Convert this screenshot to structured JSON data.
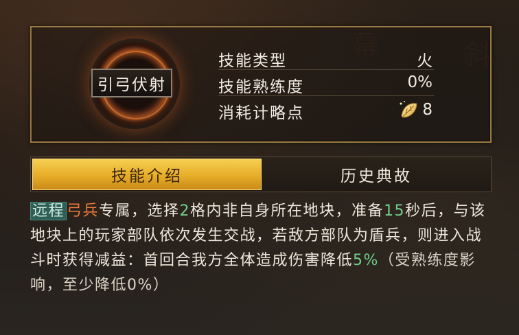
{
  "skill": {
    "name": "引弓伏射",
    "stats": [
      {
        "label": "技能类型",
        "value": "火"
      },
      {
        "label": "技能熟练度",
        "value": "0%"
      },
      {
        "label": "消耗计略点",
        "value": "8",
        "icon": "gold-leaf-icon"
      }
    ]
  },
  "tabs": [
    {
      "label": "技能介绍",
      "active": true
    },
    {
      "label": "历史典故",
      "active": false
    }
  ],
  "description": {
    "tag": "远程",
    "unit": "弓兵",
    "t1": "专属，选择",
    "n1": "2",
    "t2": "格内非自身所在地块，准备",
    "n2": "15",
    "t3": "秒后，与该地块上的玩家部队依次发生交战，若敌方部队为盾兵，则进入战斗时获得减益：首回合我方全体造成伤害降低",
    "n3": "5%",
    "t4": "（受熟练度影响，至少降低0%）"
  },
  "background_glyphs": [
    "幕",
    "斜"
  ],
  "colors": {
    "active_tab": "#e7ad28",
    "highlight_green": "#6fd08a",
    "highlight_orange": "#f07a3c",
    "panel_border": "#9c7b44"
  }
}
